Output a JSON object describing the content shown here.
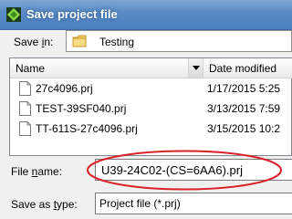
{
  "window": {
    "title": "Save project file",
    "icon": "green-diamond-app-icon",
    "title_bar_color": "#5b8cc5"
  },
  "save_in": {
    "label_prefix": "Save ",
    "label_accel": "i",
    "label_suffix": "n:",
    "folder_icon": "folder-icon",
    "value": "Testing"
  },
  "file_list": {
    "columns": [
      "Name",
      "Date modified"
    ],
    "rows": [
      {
        "name": "27c4096.prj",
        "date": "1/17/2015 5:25",
        "icon": "document-icon"
      },
      {
        "name": "TEST-39SF040.prj",
        "date": "3/13/2015 7:59",
        "icon": "document-icon"
      },
      {
        "name": "TT-611S-27c4096.prj",
        "date": "3/15/2015 10:2",
        "icon": "document-icon"
      }
    ]
  },
  "file_name": {
    "label_prefix": "File ",
    "label_accel": "n",
    "label_suffix": "ame:",
    "value": "U39-24C02-(CS=6AA6).prj",
    "highlight_color": "#d9232a"
  },
  "save_as_type": {
    "label_prefix": "Save as ",
    "label_accel": "t",
    "label_suffix": "ype:",
    "value": "Project file (*.prj)"
  }
}
